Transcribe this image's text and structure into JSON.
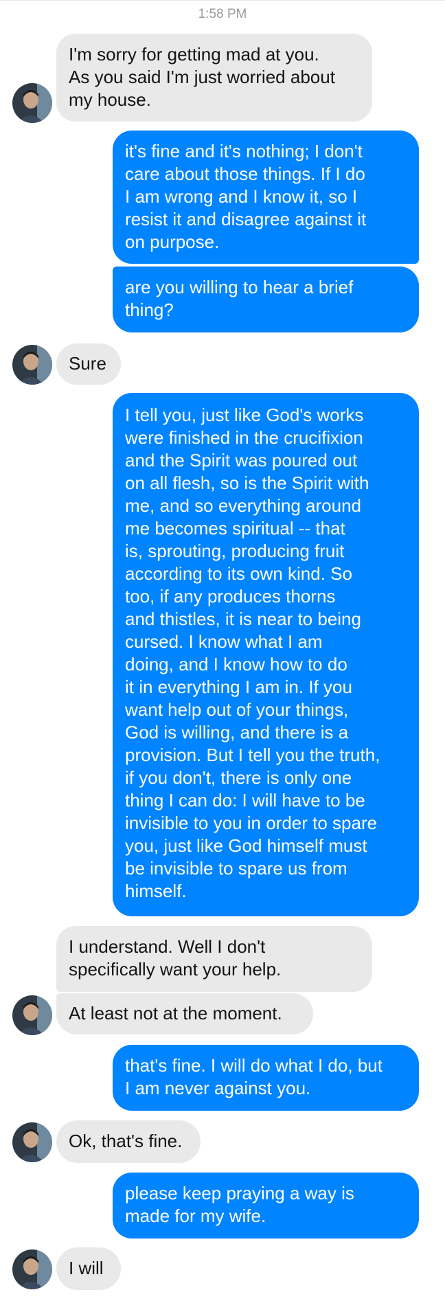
{
  "header": {
    "timestamp": "1:58 PM"
  },
  "contact": {
    "avatar_icon": "contact-avatar"
  },
  "colors": {
    "outgoing_bubble": "#0084ff",
    "incoming_bubble": "#e9e9e9",
    "timestamp_text": "#9a9a9a"
  },
  "messages": [
    {
      "from": "contact",
      "text": "I'm sorry for getting mad at you.\nAs you said I'm just worried about\nmy house."
    },
    {
      "from": "me",
      "text": "it's fine and it's nothing; I don't\ncare about those things. If I do\nI am wrong and I know it, so I\nresist it and disagree against it\non purpose."
    },
    {
      "from": "me",
      "text": "are you willing to hear a brief\nthing?"
    },
    {
      "from": "contact",
      "text": "Sure"
    },
    {
      "from": "me",
      "text": "I tell you, just like God's works\nwere finished in the crucifixion\nand the Spirit was poured out\non all flesh, so is the Spirit with\nme, and so everything around\nme becomes spiritual -- that\nis, sprouting, producing fruit\naccording to its own kind. So\ntoo, if any produces thorns\nand thistles, it is near to being\ncursed. I know what I am\ndoing, and I know how to do\nit in everything I am in. If you\nwant help out of your things,\nGod is willing, and there is a\nprovision. But I tell you the truth,\nif you don't, there is only one\nthing I can do: I will have to be\ninvisible to you in order to spare\nyou, just like God himself must\nbe invisible to spare us from\nhimself."
    },
    {
      "from": "contact",
      "text": "I understand. Well I don't\nspecifically want your help."
    },
    {
      "from": "contact",
      "text": "At least not at the moment."
    },
    {
      "from": "me",
      "text": "that's fine. I will do what I do, but\nI am never against you."
    },
    {
      "from": "contact",
      "text": "Ok, that's fine."
    },
    {
      "from": "me",
      "text": "please keep praying a way is\nmade for my wife."
    },
    {
      "from": "contact",
      "text": "I will"
    }
  ]
}
